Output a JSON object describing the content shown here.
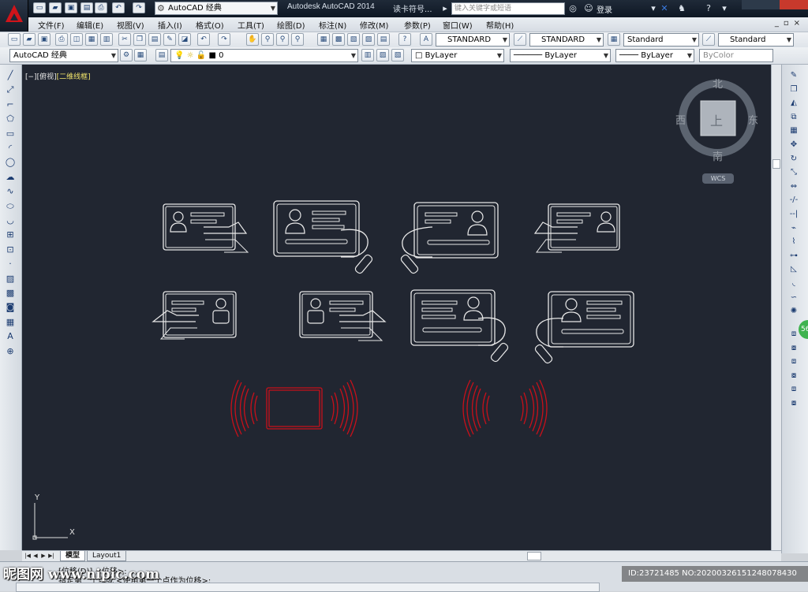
{
  "titlebar": {
    "workspace": "AutoCAD 经典",
    "app_title": "Autodesk AutoCAD 2014",
    "doc_title": "读卡符号...",
    "search_placeholder": "键入关键字或短语",
    "login_label": "登录"
  },
  "menu": {
    "items": [
      "文件(F)",
      "编辑(E)",
      "视图(V)",
      "插入(I)",
      "格式(O)",
      "工具(T)",
      "绘图(D)",
      "标注(N)",
      "修改(M)",
      "参数(P)",
      "窗口(W)",
      "帮助(H)"
    ]
  },
  "toolbar1": {
    "text_style": "STANDARD",
    "dim_style": "STANDARD",
    "table_style": "Standard",
    "multileader_style": "Standard"
  },
  "toolbar2": {
    "workspace": "AutoCAD 经典",
    "layer": "0",
    "color": "ByLayer",
    "linetype": "ByLayer",
    "lineweight": "ByLayer",
    "plotstyle": "ByColor"
  },
  "viewport": {
    "label_prefix": "[−][俯视]",
    "label_style": "[二维线框]",
    "compass": {
      "north": "北",
      "south": "南",
      "east": "东",
      "west": "西",
      "top": "上"
    },
    "wcs": "WCS",
    "ucs_x": "X",
    "ucs_y": "Y"
  },
  "tabs": {
    "model": "模型",
    "layout1": "Layout1"
  },
  "command": {
    "line1": "[位移(D)] <位移>:",
    "line2": "指定第二个点或 <使用第一个点作为位移>:"
  },
  "watermark": {
    "site": "昵图网 www.nipic.com",
    "id": "ID:23721485 NO:20200326151248078430"
  },
  "colors": {
    "canvas_bg": "#212631",
    "line_white": "#e8e8e8",
    "line_red": "#c8101a",
    "accent": "#d0141a"
  },
  "icons": {
    "left_toolbar": [
      "line-icon",
      "construction-line-icon",
      "polyline-icon",
      "polygon-icon",
      "rectangle-icon",
      "arc-icon",
      "circle-icon",
      "revcloud-icon",
      "spline-icon",
      "ellipse-icon",
      "ellipse-arc-icon",
      "insert-block-icon",
      "make-block-icon",
      "point-icon",
      "hatch-icon",
      "gradient-icon",
      "region-icon",
      "table-icon",
      "mtext-icon",
      "add-selected-icon"
    ],
    "right_toolbar": [
      "erase-icon",
      "copy-icon",
      "mirror-icon",
      "offset-icon",
      "array-icon",
      "move-icon",
      "rotate-icon",
      "scale-icon",
      "stretch-icon",
      "trim-icon",
      "extend-icon",
      "break-point-icon",
      "break-icon",
      "join-icon",
      "chamfer-icon",
      "fillet-icon",
      "blend-icon",
      "explode-icon",
      "draworder-front-icon",
      "draworder-back-icon",
      "draworder-above-icon",
      "draworder-under-icon",
      "draworder-text-icon",
      "draworder-dims-icon"
    ]
  }
}
